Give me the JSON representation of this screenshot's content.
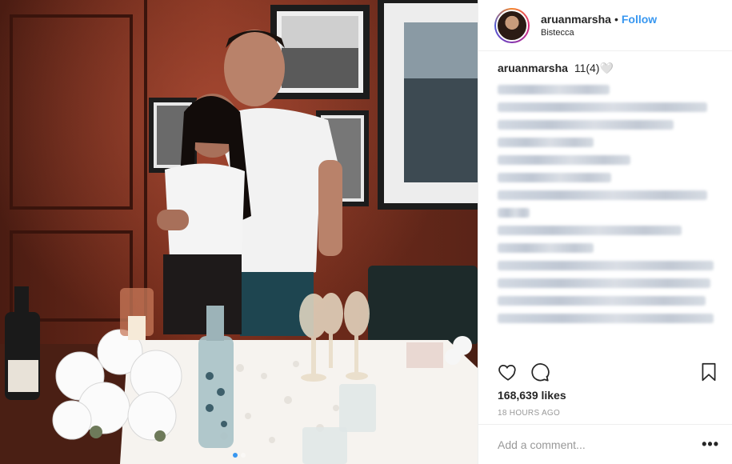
{
  "post": {
    "username": "aruanmarsha",
    "separator": "•",
    "follow_label": "Follow",
    "location": "Bistecca",
    "caption_user": "aruanmarsha",
    "caption_text": "11(4)🤍",
    "likes": "168,639 likes",
    "time": "18 HOURS AGO",
    "comment_placeholder": "Add a comment...",
    "more_label": "•••",
    "carousel_pages": 2,
    "carousel_active": 1
  },
  "icons": {
    "like": "heart-icon",
    "comment": "comment-icon",
    "save": "bookmark-icon"
  },
  "colors": {
    "link": "#3897f0",
    "text": "#262626",
    "muted": "#999999"
  }
}
